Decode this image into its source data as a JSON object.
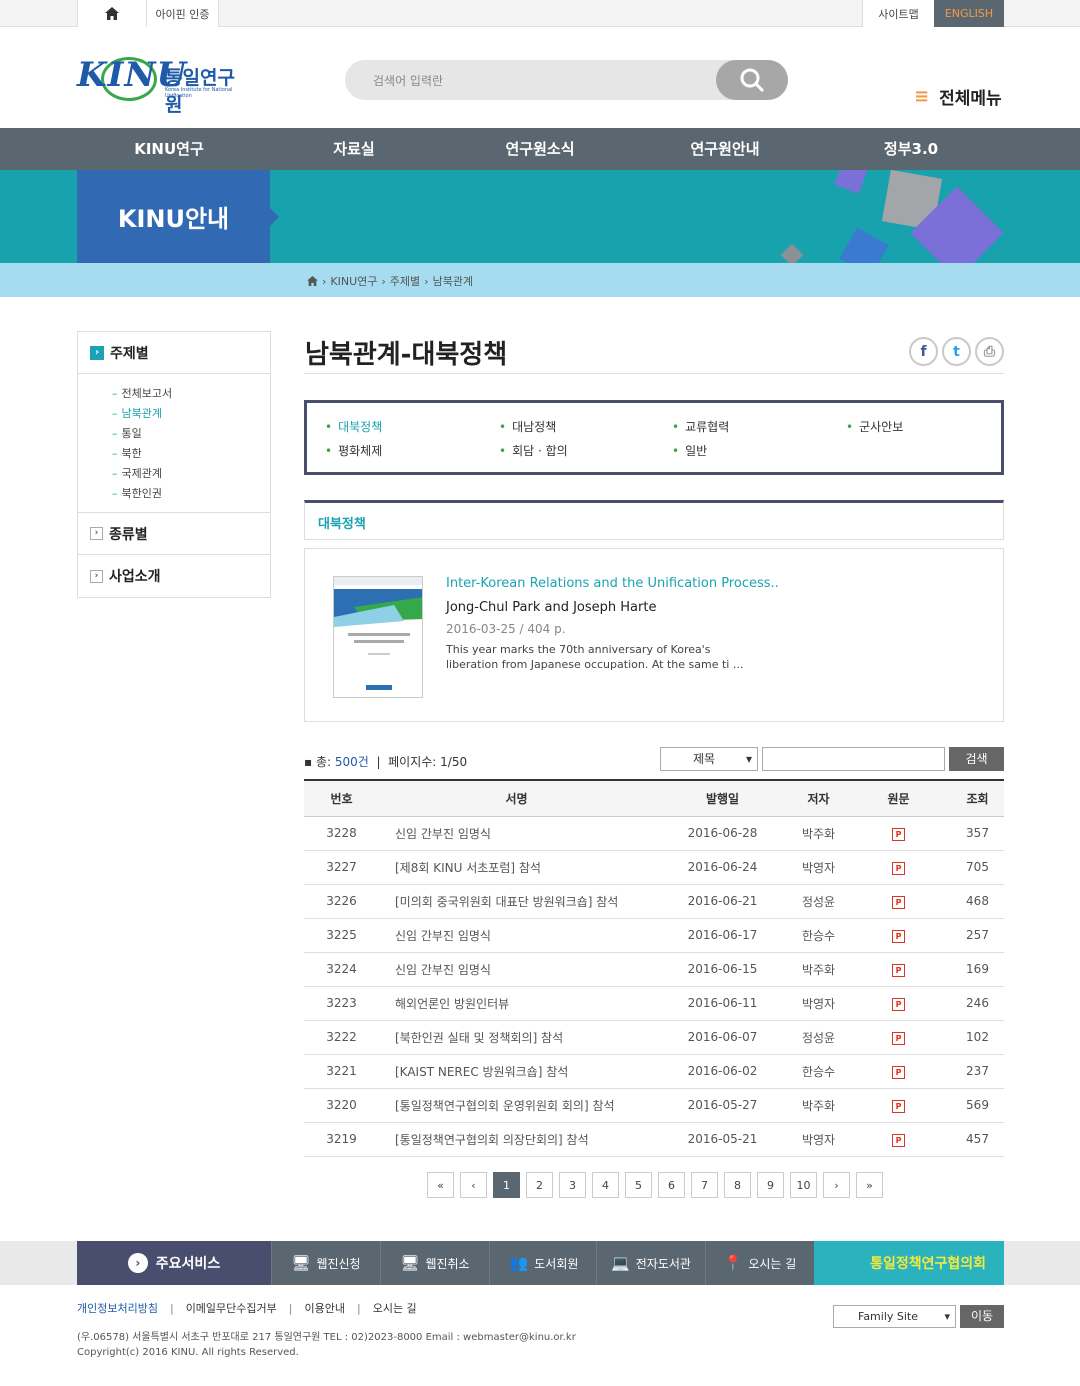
{
  "topbar": {
    "ipin": "아이핀 인증",
    "sitemap": "사이트맵",
    "english": "ENGLISH"
  },
  "logo": {
    "kinu": "KINU",
    "name": "통일연구원",
    "sub": "Korea Institute for National Unification"
  },
  "search": {
    "placeholder": "검색어 입력란"
  },
  "allmenu": "전체메뉴",
  "gnb": [
    "KINU연구",
    "자료실",
    "연구원소식",
    "연구원안내",
    "정부3.0"
  ],
  "banner": {
    "title": "KINU안내"
  },
  "breadcrumb": [
    "KINU연구",
    "주제별",
    "남북관계"
  ],
  "lnb": {
    "head": "주제별",
    "items": [
      "전체보고서",
      "남북관계",
      "통일",
      "북한",
      "국제관계",
      "북한인권"
    ],
    "sub1": "종류별",
    "sub2": "사업소개"
  },
  "page_title": "남북관계-대북정책",
  "categories": [
    "대북정책",
    "대남정책",
    "교류협력",
    "군사안보",
    "평화체제",
    "회담 · 합의",
    "일반"
  ],
  "section_title": "대북정책",
  "featured": {
    "title": "Inter-Korean Relations and the Unification Process..",
    "authors": "Jong-Chul Park and Joseph Harte",
    "date_pages": "2016-03-25 / 404 p.",
    "summary": "This year marks the 70th anniversary of Korea's liberation from Japanese occupation. At the same ti ..."
  },
  "list": {
    "total_label": "총: ",
    "total": "500건",
    "pages_label": "페이지수: 1/50",
    "select": "제목",
    "search_btn": "검색"
  },
  "table": {
    "headers": [
      "번호",
      "서명",
      "발행일",
      "저자",
      "원문",
      "조회"
    ],
    "rows": [
      [
        "3228",
        "신임 간부진 임명식",
        "2016-06-28",
        "박주화",
        "357"
      ],
      [
        "3227",
        "[제8회 KINU 서초포럼] 참석",
        "2016-06-24",
        "박영자",
        "705"
      ],
      [
        "3226",
        "[미의회 중국위원회 대표단 방원워크숍] 참석",
        "2016-06-21",
        "정성윤",
        "468"
      ],
      [
        "3225",
        "신임 간부진 임명식",
        "2016-06-17",
        "한승수",
        "257"
      ],
      [
        "3224",
        "신임 간부진 임명식",
        "2016-06-15",
        "박주화",
        "169"
      ],
      [
        "3223",
        "해외언론인 방원인터뷰",
        "2016-06-11",
        "박영자",
        "246"
      ],
      [
        "3222",
        "[북한인권 실태 및 정책회의] 참석",
        "2016-06-07",
        "정성윤",
        "102"
      ],
      [
        "3221",
        "[KAIST NEREC 방원워크숍] 참석",
        "2016-06-02",
        "한승수",
        "237"
      ],
      [
        "3220",
        "[통일정책연구협의회 운영위원회 회의] 참석",
        "2016-05-27",
        "박주화",
        "569"
      ],
      [
        "3219",
        "[통일정책연구협의회 의장단회의] 참석",
        "2016-05-21",
        "박영자",
        "457"
      ]
    ]
  },
  "paging": [
    "1",
    "2",
    "3",
    "4",
    "5",
    "6",
    "7",
    "8",
    "9",
    "10"
  ],
  "services": {
    "head": "주요서비스",
    "items": [
      "웹진신청",
      "웹진취소",
      "도서회원",
      "전자도서관",
      "오시는 길"
    ],
    "council": "통일정책연구협의회"
  },
  "footer": {
    "links": [
      "개인정보처리방침",
      "이메일무단수집거부",
      "이용안내",
      "오시는 길"
    ],
    "address": "(우.06578) 서울특별시 서초구 반포대로 217 통일연구원   TEL : 02)2023-8000   Email : webmaster@kinu.or.kr",
    "copyright": "Copyright(c) 2016 KINU. All rights Reserved.",
    "family": "Family Site",
    "move": "이동"
  },
  "colors": {
    "accent": "#1aa3b3",
    "nav": "#5b6770",
    "banner": "#17a2ad",
    "title_block": "#3169b3",
    "orange": "#f39a47"
  }
}
